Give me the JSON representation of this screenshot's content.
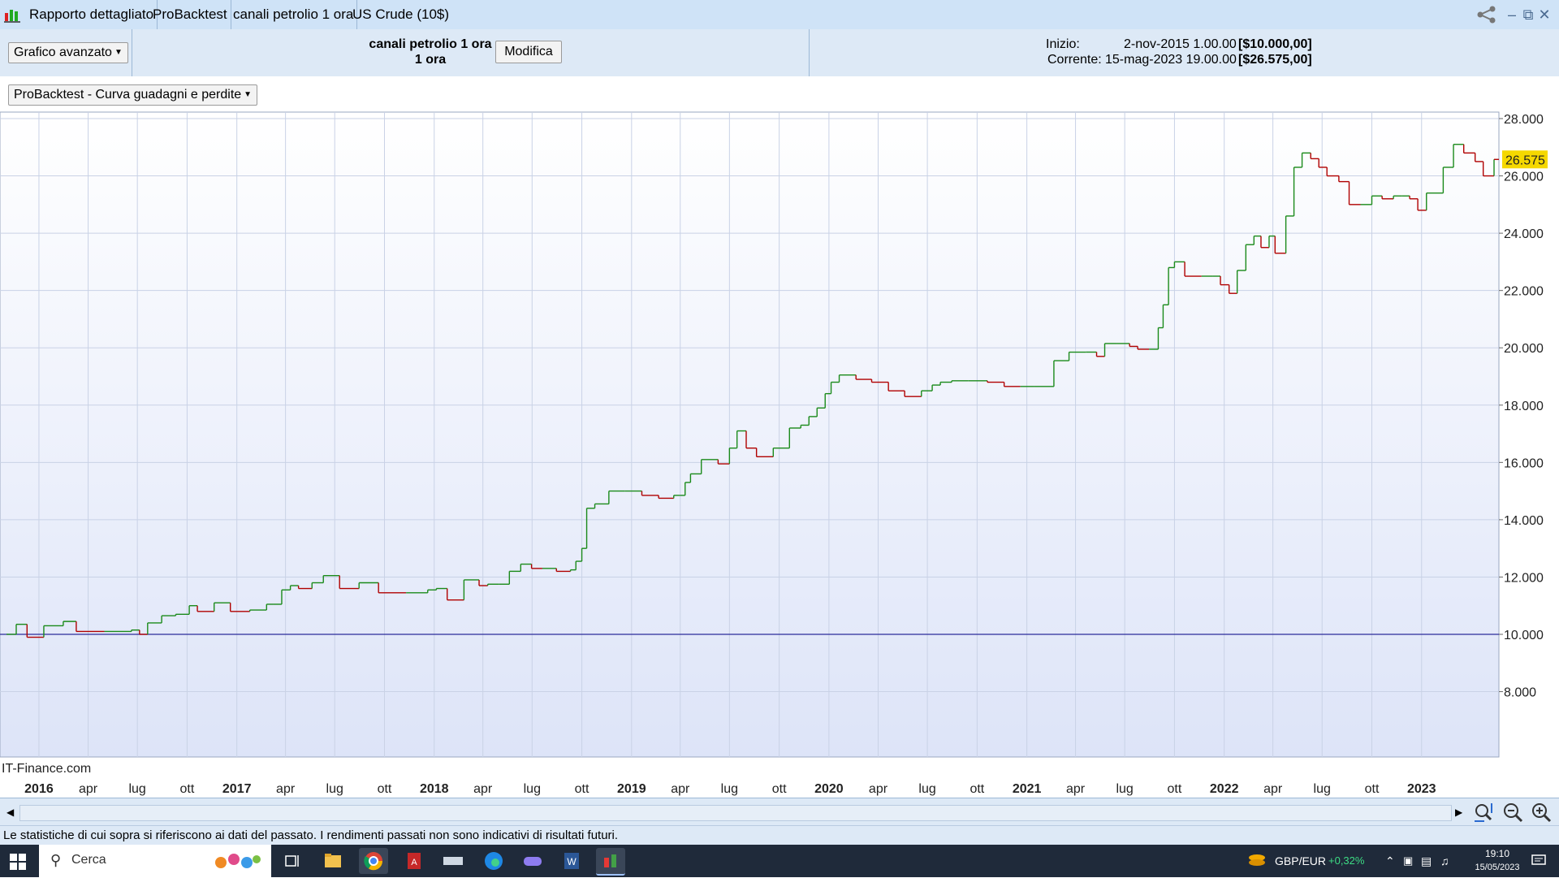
{
  "titlebar": {
    "tabs": [
      "Rapporto dettagliato",
      "ProBacktest",
      "canali petrolio 1 ora",
      "US Crude (10$)"
    ]
  },
  "header": {
    "chart_mode": "Grafico avanzato",
    "strategy_name": "canali petrolio 1 ora",
    "timeframe": "1 ora",
    "modify_label": "Modifica",
    "start_label": "Inizio:",
    "start_value": "2-nov-2015 1.00.00",
    "start_amount": "[$10.000,00]",
    "current_label": "Corrente:",
    "current_value": "15-mag-2023 19.00.00",
    "current_amount": "[$26.575,00]"
  },
  "indicator_select": "ProBacktest - Curva guadagni e perdite",
  "watermark": "IT-Finance.com",
  "status_text": "Le statistiche di cui sopra si riferiscono ai dati del passato. I rendimenti passati non sono indicativi di risultati futuri.",
  "taskbar": {
    "search_placeholder": "Cerca",
    "ticker_name": "GBP/EUR",
    "ticker_change": "+0,32%",
    "clock_time": "19:10",
    "clock_date": "15/05/2023"
  },
  "colors": {
    "up": "#1a8a1a",
    "down": "#b00000",
    "baseline": "#2b2b9a",
    "last_price_bg": "#f5d800"
  },
  "chart_data": {
    "type": "line",
    "title": "ProBacktest - Curva guadagni e perdite",
    "ylim": [
      8000,
      28500
    ],
    "y_ticks": [
      "8.000",
      "10.000",
      "12.000",
      "14.000",
      "16.000",
      "18.000",
      "20.000",
      "22.000",
      "24.000",
      "26.000",
      "28.000"
    ],
    "x_ticks": [
      {
        "label": "2016",
        "bold": true
      },
      {
        "label": "apr"
      },
      {
        "label": "lug"
      },
      {
        "label": "ott"
      },
      {
        "label": "2017",
        "bold": true
      },
      {
        "label": "apr"
      },
      {
        "label": "lug"
      },
      {
        "label": "ott"
      },
      {
        "label": "2018",
        "bold": true
      },
      {
        "label": "apr"
      },
      {
        "label": "lug"
      },
      {
        "label": "ott"
      },
      {
        "label": "2019",
        "bold": true
      },
      {
        "label": "apr"
      },
      {
        "label": "lug"
      },
      {
        "label": "ott"
      },
      {
        "label": "2020",
        "bold": true
      },
      {
        "label": "apr"
      },
      {
        "label": "lug"
      },
      {
        "label": "ott"
      },
      {
        "label": "2021",
        "bold": true
      },
      {
        "label": "apr"
      },
      {
        "label": "lug"
      },
      {
        "label": "ott"
      },
      {
        "label": "2022",
        "bold": true
      },
      {
        "label": "apr"
      },
      {
        "label": "lug"
      },
      {
        "label": "ott"
      },
      {
        "label": "2023",
        "bold": true
      }
    ],
    "baseline": 10000,
    "last_value_label": "26.575",
    "x_start": "2015-11-02",
    "x_end": "2023-05-15",
    "series": [
      {
        "x": [
          "2015-11-02",
          "2015-11-20",
          "2015-12-10",
          "2016-01-10",
          "2016-02-15",
          "2016-03-10",
          "2016-05-01",
          "2016-06-20",
          "2016-07-05",
          "2016-07-20",
          "2016-08-15",
          "2016-09-10",
          "2016-10-05",
          "2016-10-20",
          "2016-11-20",
          "2016-12-20",
          "2017-01-25",
          "2017-02-25",
          "2017-03-10",
          "2017-03-25",
          "2017-04-10",
          "2017-04-25",
          "2017-05-20",
          "2017-06-10",
          "2017-07-10",
          "2017-08-15",
          "2017-09-20",
          "2017-11-10",
          "2017-12-20",
          "2018-01-05",
          "2018-01-25",
          "2018-02-25",
          "2018-03-25",
          "2018-04-10",
          "2018-05-01",
          "2018-05-20",
          "2018-06-10",
          "2018-06-30",
          "2018-07-20",
          "2018-08-15",
          "2018-09-10",
          "2018-09-20",
          "2018-10-01",
          "2018-10-10",
          "2018-10-25",
          "2018-11-20",
          "2018-12-20",
          "2019-01-20",
          "2019-02-20",
          "2019-03-20",
          "2019-04-01",
          "2019-04-10",
          "2019-04-20",
          "2019-05-10",
          "2019-06-10",
          "2019-07-01",
          "2019-07-15",
          "2019-08-01",
          "2019-08-20",
          "2019-09-20",
          "2019-10-20",
          "2019-11-10",
          "2019-11-25",
          "2019-12-10",
          "2019-12-25",
          "2020-01-05",
          "2020-01-20",
          "2020-02-20",
          "2020-03-20",
          "2020-04-20",
          "2020-05-20",
          "2020-06-20",
          "2020-07-10",
          "2020-07-25",
          "2020-08-15",
          "2020-09-15",
          "2020-10-20",
          "2020-11-20",
          "2020-12-20",
          "2021-01-15",
          "2021-02-20",
          "2021-03-20",
          "2021-04-20",
          "2021-05-10",
          "2021-05-25",
          "2021-06-15",
          "2021-07-10",
          "2021-07-25",
          "2021-08-15",
          "2021-09-01",
          "2021-09-10",
          "2021-09-20",
          "2021-10-01",
          "2021-10-20",
          "2021-11-20",
          "2021-12-10",
          "2021-12-25",
          "2022-01-10",
          "2022-01-25",
          "2022-02-10",
          "2022-02-25",
          "2022-03-10",
          "2022-03-25",
          "2022-04-05",
          "2022-04-25",
          "2022-05-10",
          "2022-05-25",
          "2022-06-10",
          "2022-06-25",
          "2022-07-10",
          "2022-08-01",
          "2022-08-20",
          "2022-09-10",
          "2022-10-01",
          "2022-10-20",
          "2022-11-10",
          "2022-11-25",
          "2022-12-10",
          "2022-12-25",
          "2023-01-10",
          "2023-02-10",
          "2023-03-01",
          "2023-03-20",
          "2023-04-10",
          "2023-04-25",
          "2023-05-15"
        ],
        "y": [
          10000,
          10350,
          9900,
          10300,
          10450,
          10100,
          10100,
          10150,
          10000,
          10400,
          10650,
          10700,
          11000,
          10800,
          11100,
          10800,
          10850,
          11050,
          11050,
          11550,
          11700,
          11600,
          11800,
          12050,
          11600,
          11800,
          11450,
          11450,
          11550,
          11600,
          11200,
          11900,
          11700,
          11750,
          11750,
          12200,
          12450,
          12300,
          12300,
          12200,
          12250,
          12550,
          13000,
          14400,
          14550,
          15000,
          15000,
          14850,
          14750,
          14850,
          14850,
          15300,
          15600,
          16100,
          15950,
          16500,
          17100,
          16500,
          16200,
          16500,
          17200,
          17300,
          17600,
          17900,
          18400,
          18800,
          19050,
          18900,
          18800,
          18500,
          18300,
          18500,
          18700,
          18800,
          18850,
          18850,
          18800,
          18650,
          18650,
          18650,
          19550,
          19850,
          19850,
          19700,
          20150,
          20150,
          20050,
          19950,
          19950,
          20700,
          21500,
          22800,
          23000,
          22500,
          22500,
          22500,
          22200,
          21900,
          22700,
          23600,
          23900,
          23500,
          23900,
          23300,
          24600,
          26300,
          26800,
          26600,
          26300,
          26000,
          25800,
          25000,
          25000,
          25300,
          25200,
          25300,
          25300,
          25200,
          24800,
          25400,
          26300,
          27100,
          26800,
          26500,
          26000,
          26575
        ]
      }
    ]
  }
}
